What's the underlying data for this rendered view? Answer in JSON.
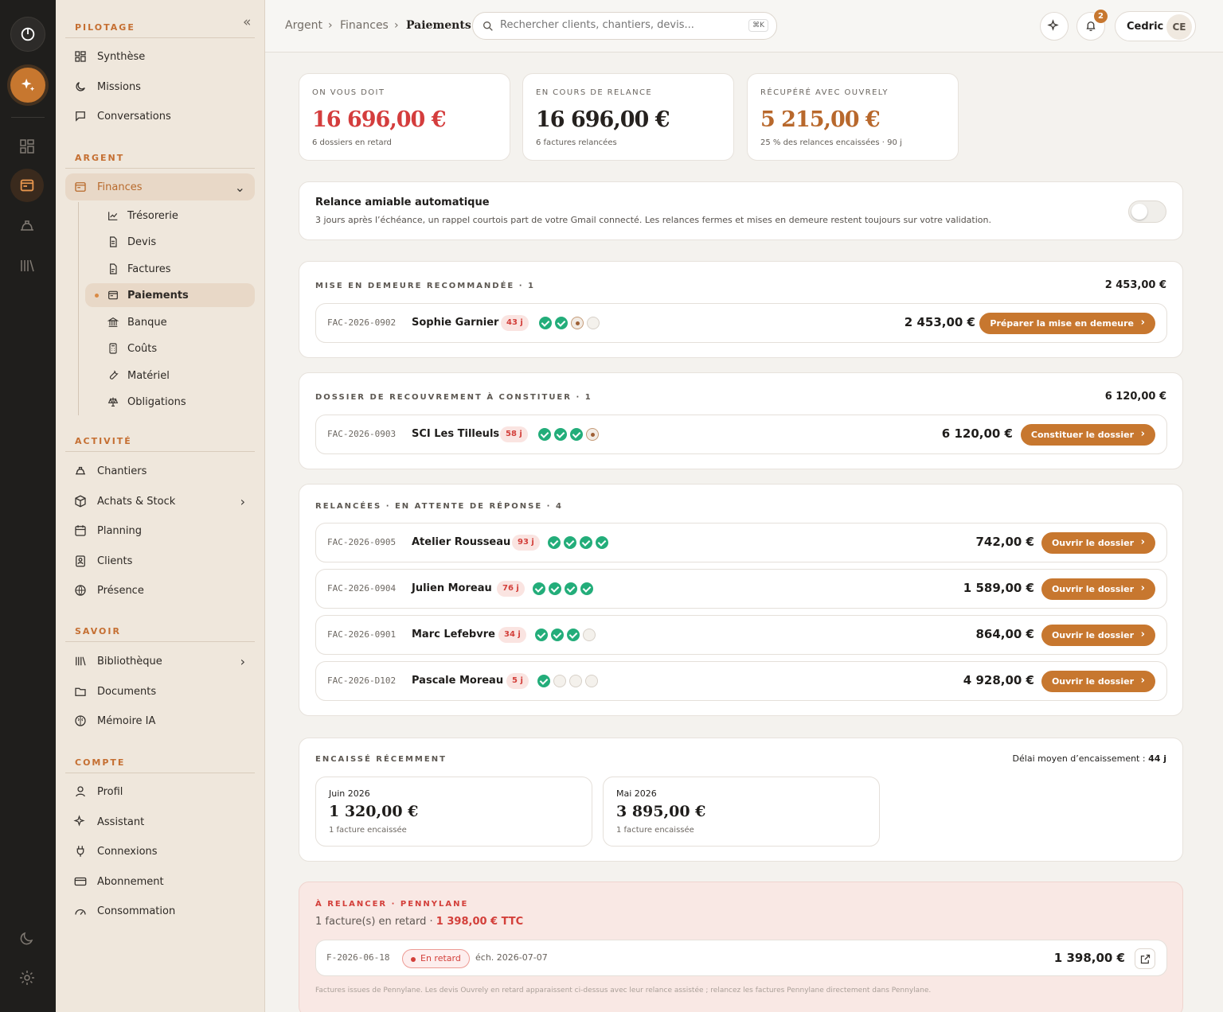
{
  "sidebar": {
    "sections": [
      "PILOTAGE",
      "ARGENT",
      "ACTIVITÉ",
      "SAVOIR",
      "COMPTE"
    ],
    "items": [
      "Synthèse",
      "Missions",
      "Conversations",
      "Finances",
      "Trésorerie",
      "Devis",
      "Factures",
      "Paiements",
      "Banque",
      "Coûts",
      "Matériel",
      "Obligations",
      "Chantiers",
      "Achats & Stock",
      "Planning",
      "Clients",
      "Présence",
      "Bibliothèque",
      "Documents",
      "Mémoire IA",
      "Profil",
      "Assistant",
      "Connexions",
      "Abonnement",
      "Consommation"
    ]
  },
  "topbar": {
    "breadcrumbs": [
      "Argent",
      "Finances",
      "Paiements"
    ],
    "search_placeholder": "Rechercher clients, chantiers, devis...",
    "shortcut": "⌘K",
    "notifications": "2",
    "user": "Cedric",
    "initials": "CE"
  },
  "kpis": [
    {
      "label": "ON VOUS DOIT",
      "value": "16 696,00 €",
      "sub": "6 dossiers en retard",
      "color": "#d43d3d"
    },
    {
      "label": "EN COURS DE RELANCE",
      "value": "16 696,00 €",
      "sub": "6 factures relancées",
      "color": "#25211e"
    },
    {
      "label": "RÉCUPÉRÉ AVEC OUVRELY",
      "value": "5 215,00 €",
      "sub": "25 % des relances encaissées · 90 j",
      "color": "#b8682c"
    }
  ],
  "auto": {
    "title": "Relance amiable automatique",
    "desc": "3 jours après l’échéance, un rappel courtois part de votre Gmail connecté. Les relances fermes et mises en demeure restent toujours sur votre validation."
  },
  "sections": [
    {
      "title": "MISE EN DEMEURE RECOMMANDÉE · 1",
      "total": "2 453,00 €",
      "rows": [
        {
          "id": "FAC-2026-0902",
          "client": "Sophie Garnier",
          "days": "43 j",
          "steps": [
            "done",
            "done",
            "current",
            "pending"
          ],
          "amount": "2 453,00 €",
          "action": "Préparer la mise en demeure"
        }
      ]
    },
    {
      "title": "DOSSIER DE RECOUVREMENT À CONSTITUER · 1",
      "total": "6 120,00 €",
      "rows": [
        {
          "id": "FAC-2026-0903",
          "client": "SCI Les Tilleuls",
          "days": "58 j",
          "steps": [
            "done",
            "done",
            "done",
            "current"
          ],
          "amount": "6 120,00 €",
          "action": "Constituer le dossier"
        }
      ]
    },
    {
      "title": "RELANCÉES · EN ATTENTE DE RÉPONSE · 4",
      "total": "",
      "rows": [
        {
          "id": "FAC-2026-0905",
          "client": "Atelier Rousseau",
          "days": "93 j",
          "steps": [
            "done",
            "done",
            "done",
            "done"
          ],
          "amount": "742,00 €",
          "action": "Ouvrir le dossier"
        },
        {
          "id": "FAC-2026-0904",
          "client": "Julien Moreau",
          "days": "76 j",
          "steps": [
            "done",
            "done",
            "done",
            "done"
          ],
          "amount": "1 589,00 €",
          "action": "Ouvrir le dossier"
        },
        {
          "id": "FAC-2026-0901",
          "client": "Marc Lefebvre",
          "days": "34 j",
          "steps": [
            "done",
            "done",
            "done",
            "pending"
          ],
          "amount": "864,00 €",
          "action": "Ouvrir le dossier"
        },
        {
          "id": "FAC-2026-D102",
          "client": "Pascale Moreau",
          "days": "5 j",
          "steps": [
            "done",
            "pending",
            "pending",
            "pending"
          ],
          "amount": "4 928,00 €",
          "action": "Ouvrir le dossier"
        }
      ]
    }
  ],
  "cashed": {
    "title": "ENCAISSÉ RÉCEMMENT",
    "avg_label": "Délai moyen d’encaissement : ",
    "avg_value": "44 j",
    "months": [
      {
        "month": "Juin 2026",
        "value": "1 320,00 €",
        "count": "1 facture encaissée"
      },
      {
        "month": "Mai 2026",
        "value": "3 895,00 €",
        "count": "1 facture encaissée"
      }
    ]
  },
  "pennylane": {
    "title": "À RELANCER · PENNYLANE",
    "summary": "1 facture(s) en retard · ",
    "summary_amount": "1 398,00 € TTC",
    "invoice": "F-2026-06-18",
    "status": "En retard",
    "due": "éch. 2026-07-07",
    "amount": "1 398,00 €",
    "note": "Factures issues de Pennylane. Les devis Ouvrely en retard apparaissent ci-dessus avec leur relance assistée ; relancez les factures Pennylane directement dans Pennylane."
  }
}
